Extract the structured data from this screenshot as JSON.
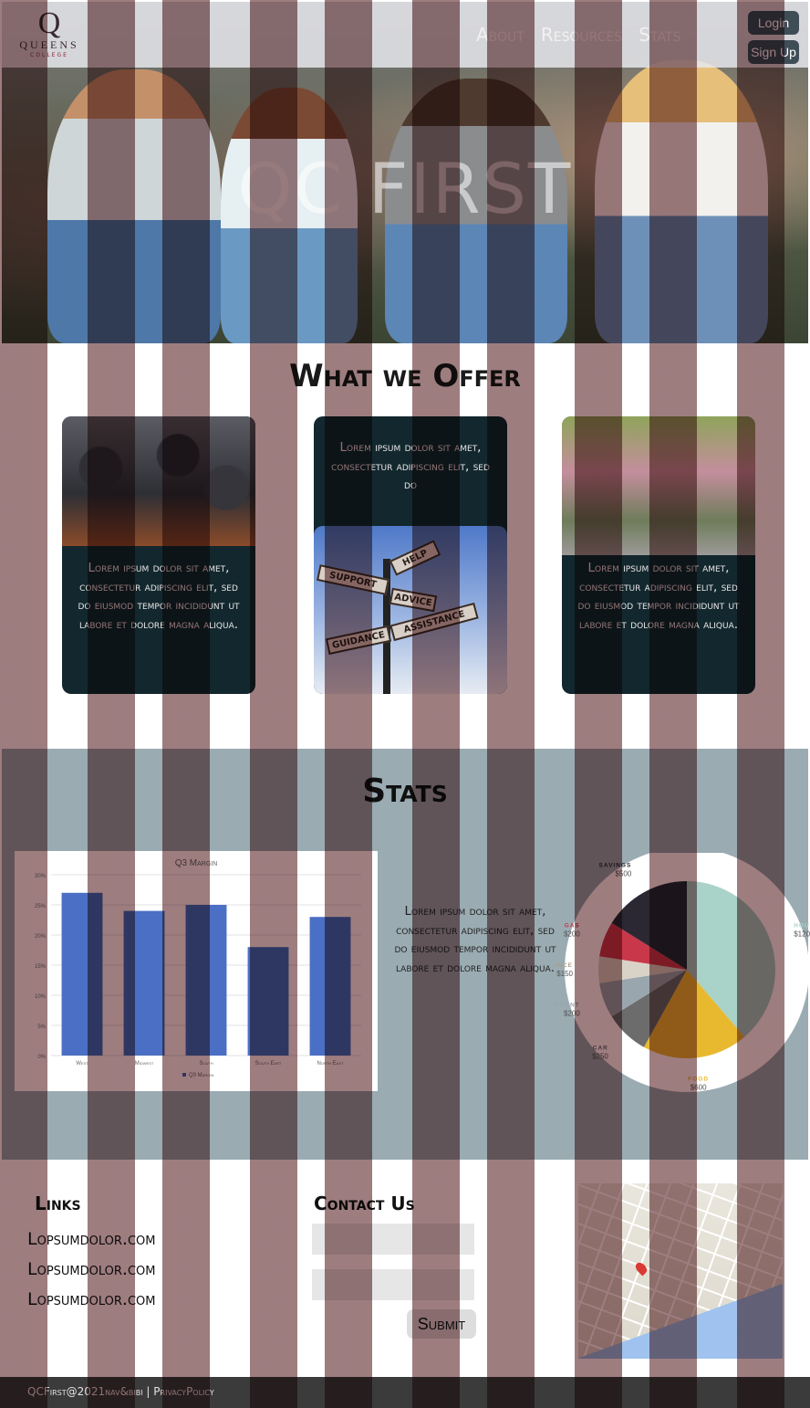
{
  "brand": {
    "logo_letter": "Q",
    "logo_name": "QUEENS",
    "logo_sub": "COLLEGE"
  },
  "nav": {
    "about": "About",
    "resources": "Resources",
    "stats": "Stats",
    "login": "Login",
    "signup": "Sign Up"
  },
  "hero": {
    "title": "QC FIRST"
  },
  "offer": {
    "title": "What we Offer",
    "cards": [
      {
        "text": "Lorem ipsum dolor sit amet, consectetur adipiscing elit, sed do eiusmod tempor incididunt ut labore et dolore magna aliqua."
      },
      {
        "text": "Lorem ipsum dolor sit amet, consectetur adipiscing elit, sed do"
      },
      {
        "text": "Lorem ipsum dolor sit amet, consectetur adipiscing elit, sed do eiusmod tempor incididunt ut labore et dolore magna aliqua."
      }
    ],
    "sign_labels": [
      "HELP",
      "SUPPORT",
      "ADVICE",
      "ASSISTANCE",
      "GUIDANCE"
    ]
  },
  "stats": {
    "title": "Stats",
    "text": "Lorem ipsum dolor sit amet,  consectetur adipiscing elit, sed do eiusmod tempor incididunt ut labore et dolore magna aliqua."
  },
  "chart_data": [
    {
      "type": "bar",
      "title": "Q3 Margin",
      "categories": [
        "West",
        "Midwest",
        "South",
        "South East",
        "North East"
      ],
      "values": [
        27,
        24,
        25,
        18,
        23
      ],
      "y_ticks": [
        "0%",
        "5%",
        "10%",
        "15%",
        "20%",
        "25%",
        "30%"
      ],
      "ylim": [
        0,
        30
      ],
      "legend": "Q3 Margin",
      "color": "#4a6fc4"
    },
    {
      "type": "pie",
      "slices": [
        {
          "label": "HOUSING",
          "value": 1200,
          "value_label": "$1200",
          "color": "#a9d2c8"
        },
        {
          "label": "FOOD",
          "value": 600,
          "value_label": "$600",
          "color": "#e8b92f"
        },
        {
          "label": "CAR",
          "value": 250,
          "value_label": "$250",
          "color": "#6c6c6c"
        },
        {
          "label": "ENTERTAINMENT",
          "value": 200,
          "value_label": "$200",
          "color": "#9aa6ad"
        },
        {
          "label": "INSURANCE",
          "value": 150,
          "value_label": "$150",
          "color": "#d9d3c7"
        },
        {
          "label": "GAS",
          "value": 200,
          "value_label": "$200",
          "color": "#c9374a"
        },
        {
          "label": "SAVINGS",
          "value": 500,
          "value_label": "$500",
          "color": "#2b2833"
        }
      ]
    }
  ],
  "footer": {
    "links_title": "Links",
    "links": [
      "Lopsumdolor.com",
      "Lopsumdolor.com",
      "Lopsumdolor.com"
    ],
    "contact_title": "Contact Us",
    "submit": "Submit",
    "copyright": "QCFirst@2021nav&bibi | PrivacyPolicy"
  }
}
